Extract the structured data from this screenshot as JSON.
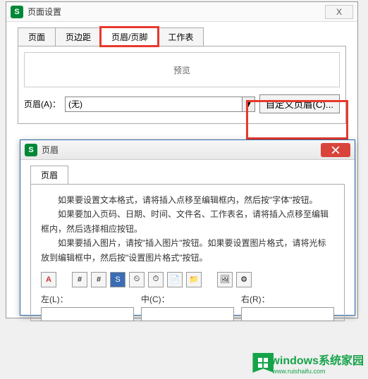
{
  "outerDialog": {
    "title": "页面设置",
    "closeGlyph": "X",
    "tabs": [
      "页面",
      "页边距",
      "页眉/页脚",
      "工作表"
    ],
    "previewLabel": "预览",
    "headerLabel": "页眉(A)：",
    "headerValue": "(无)",
    "customBtn": "自定义页眉(C)..."
  },
  "innerDialog": {
    "title": "页眉",
    "tab": "页眉",
    "help": {
      "p1": "如果要设置文本格式，请将插入点移至编辑框内，然后按\"字体\"按钮。",
      "p2": "如果要加入页码、日期、时间、文件名、工作表名，请将插入点移至编辑框内，然后选择相应按钮。",
      "p3": "如果要插入图片，请按\"插入图片\"按钮。如果要设置图片格式，请将光标放到编辑框中，然后按\"设置图片格式\"按钮。"
    },
    "toolbar": {
      "font": "A",
      "page": "#",
      "pages": "#",
      "sheet": "S",
      "date": "⏲",
      "time": "⏱",
      "file": "📄",
      "path": "📁",
      "pic": "🖼",
      "picfmt": "⚙"
    },
    "sections": {
      "left": "左(L)：",
      "center": "中(C)：",
      "right": "右(R)："
    }
  },
  "watermark": {
    "brand": "windows",
    "suffix": "系统家园",
    "url": "www.ruishaifu.com"
  }
}
